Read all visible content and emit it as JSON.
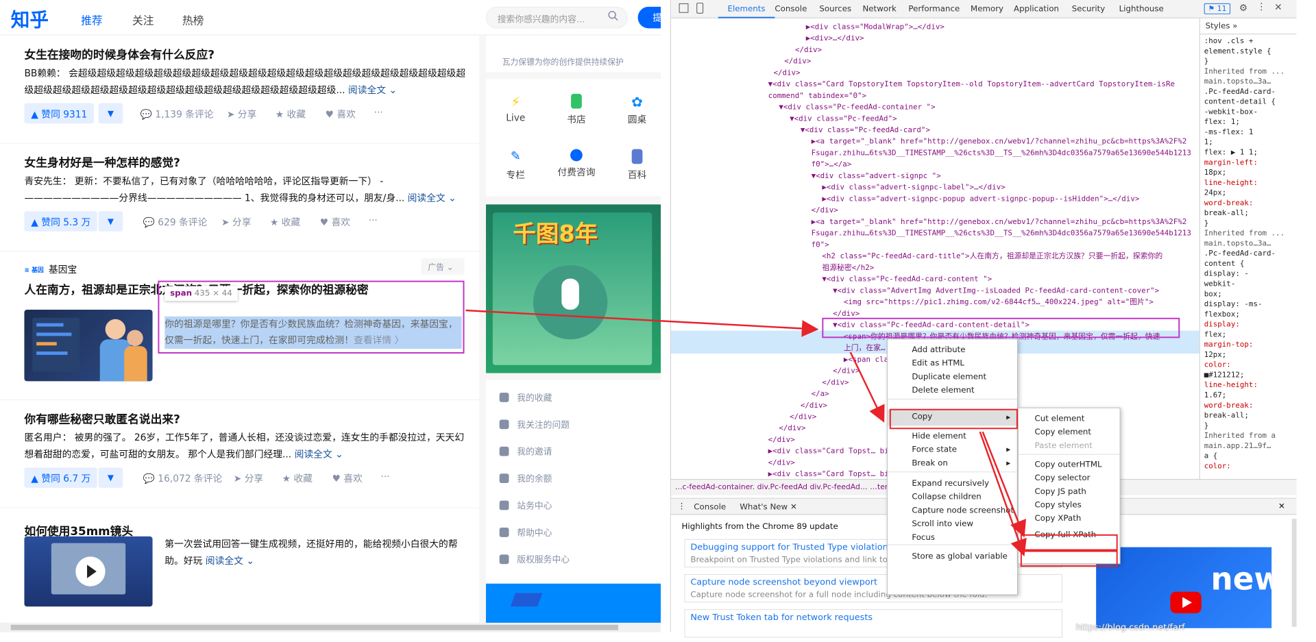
{
  "zhihu": {
    "logo": "知乎",
    "nav": [
      "推荐",
      "关注",
      "热榜"
    ],
    "search_placeholder": "搜索你感兴趣的内容...",
    "ask_button": "提问",
    "read_more": "阅读全文",
    "cards": [
      {
        "title": "女生在接吻的时候身体会有什么反应?",
        "excerpt": "BB赖赖： 会超级超级超级超级超级超级超级超级超级超级超级超级超级超级超级超级超级超级超级超级超级超级超级超级超级超级超级超级超级超级超级超级超级超级超级超级超级...",
        "vote": "▲ 赞同 9311",
        "comments": "1,139 条评论",
        "share": "分享",
        "collect": "收藏",
        "like": "喜欢"
      },
      {
        "title": "女生身材好是一种怎样的感觉?",
        "excerpt": "青安先生： 更新：不要私信了，已有对象了（哈哈哈哈哈哈，评论区指导更新一下） - ——————————分界线—————————— 1、我觉得我的身材还可以，朋友/身...",
        "vote": "▲ 赞同 5.3 万",
        "comments": "629 条评论",
        "share": "分享",
        "collect": "收藏",
        "like": "喜欢"
      },
      {
        "title": "你有哪些秘密只敢匿名说出来?",
        "excerpt": "匿名用户： 被男的强了。 26岁，工作5年了，普通人长相，还没谈过恋爱，连女生的手都没拉过，天天幻想着甜甜的恋爱，可盐可甜的女朋友。 那个人是我们部门经理...",
        "vote": "▲ 赞同 6.7 万",
        "comments": "16,072 条评论",
        "share": "分享",
        "collect": "收藏",
        "like": "喜欢"
      },
      {
        "title": "如何使用35mm镜头",
        "excerpt": "第一次尝试用回答一键生成视频，还挺好用的，能给视频小白很大的帮助。好玩"
      }
    ],
    "ad": {
      "brand": "基因宝",
      "tag": "广告",
      "title": "人在南方，祖源却是正宗北方汉族？只要一折起，探索你的祖源秘密",
      "excerpt": "你的祖源是哪里？你是否有少数民族血统？检测神奇基因，来基因宝，仅需一折起，快速上门，在家即可完成检测！",
      "detail": "查看详情 〉",
      "tooltip_tag": "span",
      "tooltip_size": "435 × 44"
    },
    "sidebar": {
      "slogan": "瓦力保镖为你的创作提供持续保护",
      "quick": [
        "Live",
        "书店",
        "圆桌",
        "专栏",
        "付费咨询",
        "百科"
      ],
      "banner_text": "千图8年",
      "menu": [
        "我的收藏",
        "我关注的问题",
        "我的邀请",
        "我的余额",
        "站务中心",
        "帮助中心",
        "版权服务中心"
      ]
    }
  },
  "devtools": {
    "tabs": [
      "Elements",
      "Console",
      "Sources",
      "Network",
      "Performance",
      "Memory",
      "Application",
      "Security",
      "Lighthouse"
    ],
    "badge": "11",
    "lines": [
      "▶<div class=\"ModalWrap\">…</div>",
      "▶<div>…</div>",
      "</div>",
      "</div>",
      "</div>",
      "▼<div class=\"Card TopstoryItem TopstoryItem--old TopstoryItem--advertCard TopstoryItem-isRe",
      "commend\" tabindex=\"0\">",
      "▼<div class=\"Pc-feedAd-container \">",
      "▼<div class=\"Pc-feedAd\">",
      "▼<div class=\"Pc-feedAd-card\">",
      "▶<a target=\"_blank\" href=\"http://genebox.cn/webv1/?channel=zhihu_pc&cb=https%3A%2F%2",
      "Fsugar.zhihu…6ts%3D__TIMESTAMP__%26cts%3D__TS__%26mh%3D4dc0356a7579a65e13690e544b1213",
      "f0\">…</a>",
      "▼<div class=\"advert-signpc \">",
      "▶<div class=\"advert-signpc-label\">…</div>",
      "▶<div class=\"advert-signpc-popup advert-signpc-popup--isHidden\">…</div>",
      "</div>",
      "▶<a target=\"_blank\" href=\"http://genebox.cn/webv1/?channel=zhihu_pc&cb=https%3A%2F%2",
      "Fsugar.zhihu…6ts%3D__TIMESTAMP__%26cts%3D__TS__%26mh%3D4dc0356a7579a65e13690e544b1213",
      "f0\">",
      "<h2 class=\"Pc-feedAd-card-title\">人在南方，祖源却是正宗北方汉族？只要一折起，探索你的",
      "祖源秘密</h2>",
      "▼<div class=\"Pc-feedAd-card-content  \">",
      "▼<div class=\"AdvertImg AdvertImg--isLoaded Pc-feedAd-card-content-cover\">",
      "<img src=\"https://pic1.zhimg.com/v2-6844cf5…_400x224.jpeg\" alt=\"图片\">",
      "</div>",
      "▼<div class=\"Pc-feedAd-card-content-detail\">",
      "<span>你的祖源是哪里？你是否有少数民族血统？检测神奇基因，来基因宝，仅需一折起，快速",
      "上门，在家…",
      "▶<span cla…                    il-cta  \">…</span>",
      "</div>",
      "</div>",
      "</a>",
      "</div>",
      "</div>",
      "</div>",
      "</div>",
      "▶<div class=\"Card Topst…                                    bindex=\"0\">…",
      "</div>",
      "▶<div class=\"Card Topst…                                    bindex=\"0\">…",
      "</div>"
    ],
    "crumbs": "…c-feedAd-container.   div.Pc-feedAd   div.Pc-feedAd…                                                        …tent-detail   span",
    "styles_tabs": [
      "Styles",
      "»"
    ],
    "styles_lines": [
      ":hov .cls +",
      "element.style {",
      "}",
      "Inherited from ...",
      "main.topsto…3a…",
      ".Pc-feedAd-card-",
      "content-detail {",
      "-webkit-box-",
      "flex: 1;",
      "-ms-flex: 1",
      "1;",
      "flex: ▶ 1 1;",
      "margin-left:",
      "18px;",
      "line-height:",
      "24px;",
      "word-break:",
      "break-all;",
      "}",
      "Inherited from ...",
      "main.topsto…3a…",
      ".Pc-feedAd-card-",
      "content {",
      "display: -",
      "webkit-",
      "box;",
      "display: -ms-",
      "flexbox;",
      "display:",
      "flex;",
      "margin-top:",
      "12px;",
      "color:",
      "■#121212;",
      "line-height:",
      "1.67;",
      "word-break:",
      "break-all;",
      "}",
      "Inherited from a",
      "main.app.21…9f…",
      "a {",
      "color:"
    ],
    "drawer_tabs": [
      "Console",
      "What's New ✕"
    ],
    "whatsnew_title": "Highlights from the Chrome 89 update",
    "whatsnew_items": [
      {
        "title": "Debugging support for Trusted Type violations",
        "desc": "Breakpoint on Trusted Type violations and link to"
      },
      {
        "title": "Capture node screenshot beyond viewport",
        "desc": "Capture node screenshot for a full node including content below the fold."
      },
      {
        "title": "New Trust Token tab for network requests",
        "desc": ""
      }
    ],
    "video_text": "new",
    "watermark": "https://blog.csdn.net/farf",
    "context_menu": [
      "Add attribute",
      "Edit as HTML",
      "Duplicate element",
      "Delete element",
      "Copy",
      "Hide element",
      "Force state",
      "Break on",
      "Expand recursively",
      "Collapse children",
      "Capture node screenshot",
      "Scroll into view",
      "Focus",
      "Store as global variable"
    ],
    "copy_menu": [
      "Cut element",
      "Copy element",
      "Paste element",
      "Copy outerHTML",
      "Copy selector",
      "Copy JS path",
      "Copy styles",
      "Copy XPath",
      "Copy full XPath"
    ]
  },
  "colors": {
    "brand": "#0066ff",
    "highlight": "#e8232a",
    "magenta": "#c133c6"
  }
}
